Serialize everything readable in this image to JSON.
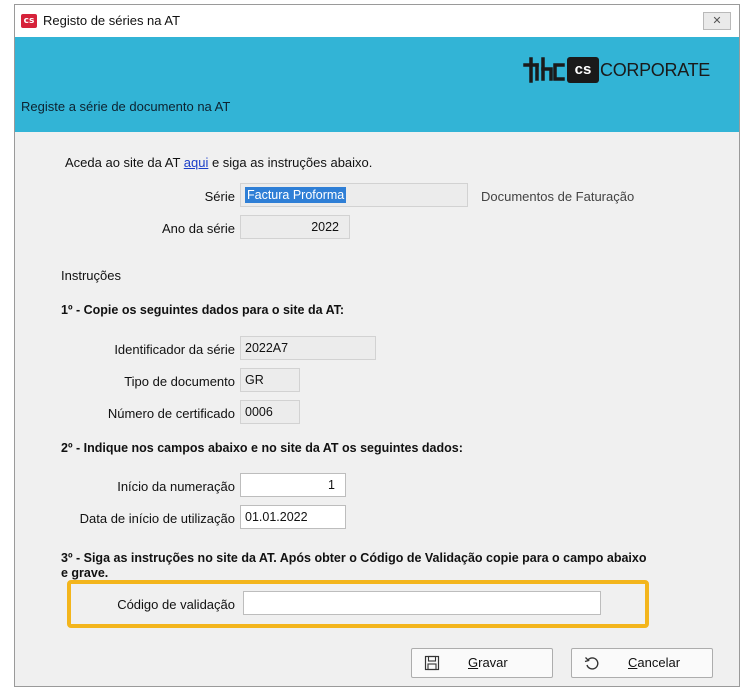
{
  "window": {
    "title": "Registo de séries na AT",
    "close_symbol": "✕",
    "app_icon_text": "cs"
  },
  "banner": {
    "text": "Registe a série de documento na AT",
    "logo": {
      "phc": "phc",
      "cs": "cs",
      "corporate": "CORPORATE"
    },
    "color": "#32b4d6"
  },
  "intro": {
    "before": "Aceda ao site da AT ",
    "link": "aqui",
    "after": " e siga as instruções abaixo."
  },
  "serie": {
    "label": "Série",
    "value": "Factura Proforma",
    "note": "Documentos de Faturação"
  },
  "ano": {
    "label": "Ano da série",
    "value": "2022"
  },
  "instrucoes_label": "Instruções",
  "step1": {
    "title": "1º - Copie os seguintes dados para o site da AT:",
    "identificador": {
      "label": "Identificador da série",
      "value": "2022A7"
    },
    "tipo": {
      "label": "Tipo de documento",
      "value": "GR"
    },
    "certificado": {
      "label": "Número de certificado",
      "value": "0006"
    }
  },
  "step2": {
    "title": "2º - Indique nos campos abaixo e no site da AT os seguintes dados:",
    "inicio_num": {
      "label": "Início da numeração",
      "value": "1"
    },
    "data_inicio": {
      "label": "Data de início de utilização",
      "value": "01.01.2022"
    }
  },
  "step3": {
    "title_line1": "3º - Siga as instruções no site da AT. Após obter o Código de Validação copie para o campo abaixo",
    "title_line2": "e grave.",
    "codigo": {
      "label": "Código de validação",
      "value": ""
    }
  },
  "buttons": {
    "gravar_first": "G",
    "gravar_rest": "ravar",
    "cancelar_first": "C",
    "cancelar_rest": "ancelar"
  },
  "colors": {
    "highlight": "#f3b51c",
    "selection": "#2f7fd6",
    "link": "#1a3ec8"
  }
}
